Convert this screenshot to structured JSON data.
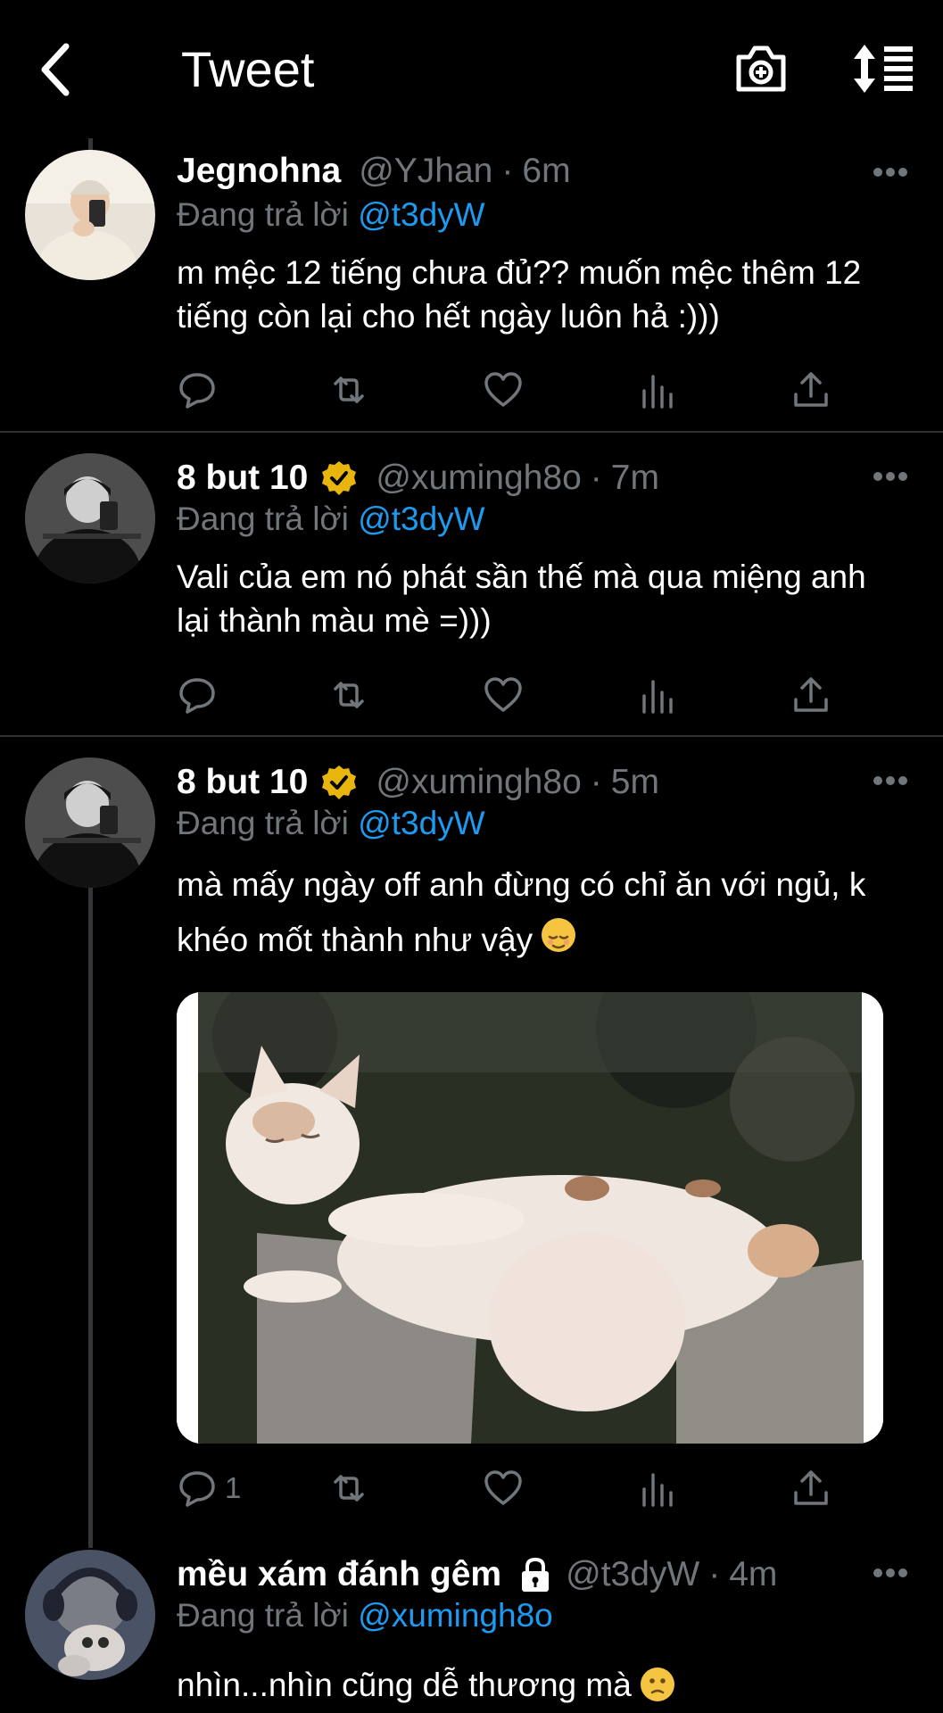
{
  "header": {
    "title": "Tweet"
  },
  "tweets": [
    {
      "name": "Jegnohna",
      "handle": "@YJhan",
      "separator": "·",
      "time": "6m",
      "replying_prefix": "Đang trả lời",
      "replying_to": "@t3dyW",
      "text": "m mệc 12 tiếng chưa đủ?? muốn mệc thêm 12 tiếng còn lại cho hết ngày luôn hả :)))"
    },
    {
      "name": "8 but 10",
      "handle": "@xumingh8o",
      "separator": "·",
      "time": "7m",
      "replying_prefix": "Đang trả lời",
      "replying_to": "@t3dyW",
      "text": "Vali của em nó phát sần thế mà qua miệng anh lại thành màu mè =)))"
    },
    {
      "name": "8 but 10",
      "handle": "@xumingh8o",
      "separator": "·",
      "time": "5m",
      "replying_prefix": "Đang trả lời",
      "replying_to": "@t3dyW",
      "text": "mà mấy ngày off anh đừng có chỉ ăn với ngủ, k khéo mốt thành như vậy",
      "reply_count": "1"
    },
    {
      "name": "mều xám đánh gêm",
      "handle": "@t3dyW",
      "separator": "·",
      "time": "4m",
      "replying_prefix": "Đang trả lời",
      "replying_to": "@xumingh8o",
      "text": "nhìn...nhìn cũng dễ thương mà"
    }
  ],
  "colors": {
    "background": "#000000",
    "accent": "#1d9bf0",
    "muted": "#71767b",
    "verified": "#e8b50e"
  }
}
